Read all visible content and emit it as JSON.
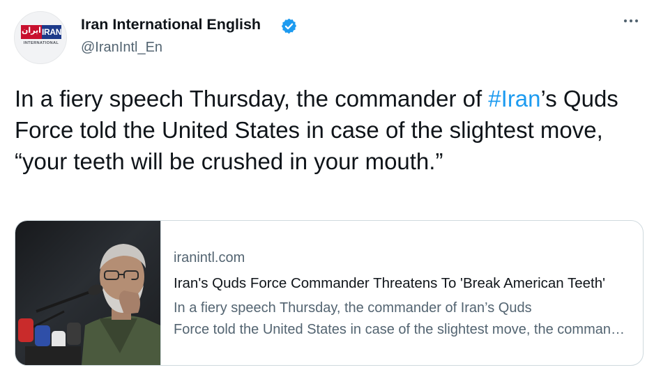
{
  "tweet": {
    "author_name": "Iran International English",
    "handle": "@IranIntl_En",
    "verified": true,
    "avatar": {
      "logo_farsi": "ایران",
      "logo_latin": "IRAN",
      "logo_sub": "INTERNATIONAL",
      "brand_red": "#c8102e",
      "brand_blue": "#1d3a8a"
    },
    "text_before": "In a fiery speech Thursday, the commander of ",
    "hashtag": "#Iran",
    "text_after": "’s Quds Force told the United States in case of the slightest move, “your teeth will be crushed in your mouth.”",
    "more_icon": "more-horizontal-icon"
  },
  "card": {
    "domain": "iranintl.com",
    "title": "Iran's Quds Force Commander Threatens To 'Break American Teeth'",
    "desc_line1": "In a fiery speech Thursday, the commander of Iran’s Quds",
    "desc_line2": "Force told the United States in case of the slightest move, the commander said",
    "image_icon": "speaker-photo"
  },
  "colors": {
    "link": "#1d9bf0",
    "secondary": "#536471",
    "border": "#cfd9de"
  }
}
